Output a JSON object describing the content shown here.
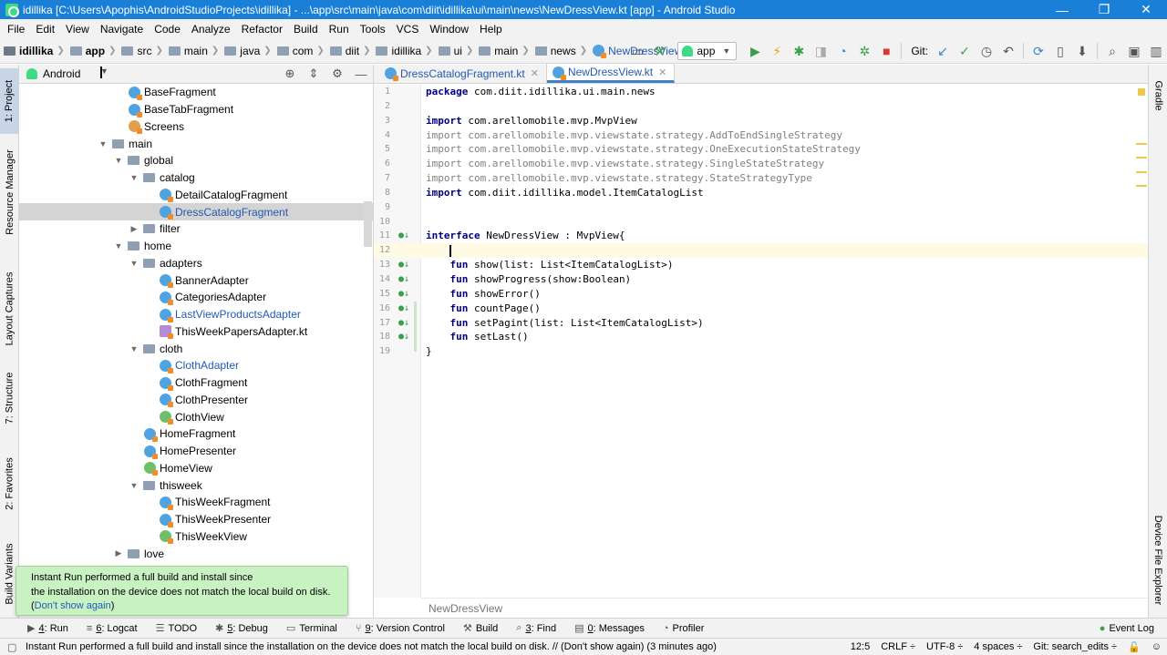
{
  "window": {
    "title": "idillika [C:\\Users\\Apophis\\AndroidStudioProjects\\idillika] - ...\\app\\src\\main\\java\\com\\diit\\idillika\\ui\\main\\news\\NewDressView.kt [app] - Android Studio"
  },
  "menu": [
    "File",
    "Edit",
    "View",
    "Navigate",
    "Code",
    "Analyze",
    "Refactor",
    "Build",
    "Run",
    "Tools",
    "VCS",
    "Window",
    "Help"
  ],
  "breadcrumbs": [
    "idillika",
    "app",
    "src",
    "main",
    "java",
    "com",
    "diit",
    "idillika",
    "ui",
    "main",
    "news",
    "NewDressView.kt"
  ],
  "toolbar": {
    "run_config": "app",
    "git_label": "Git:"
  },
  "left_tabs": [
    "1: Project",
    "Resource Manager",
    "Layout Captures",
    "7: Structure",
    "2: Favorites",
    "Build Variants"
  ],
  "right_tabs": [
    "Gradle",
    "Device File Explorer"
  ],
  "project_panel": {
    "view_mode": "Android"
  },
  "tree": [
    {
      "label": "BaseFragment",
      "indent": 8,
      "kind": "class"
    },
    {
      "label": "BaseTabFragment",
      "indent": 8,
      "kind": "class"
    },
    {
      "label": "Screens",
      "indent": 8,
      "kind": "object"
    },
    {
      "label": "main",
      "indent": 6,
      "kind": "folder",
      "arrow": "open"
    },
    {
      "label": "global",
      "indent": 7,
      "kind": "folder",
      "arrow": "open"
    },
    {
      "label": "catalog",
      "indent": 8,
      "kind": "folder",
      "arrow": "open"
    },
    {
      "label": "DetailCatalogFragment",
      "indent": 10,
      "kind": "class"
    },
    {
      "label": "DressCatalogFragment",
      "indent": 10,
      "kind": "class",
      "selected": true,
      "blue": true
    },
    {
      "label": "filter",
      "indent": 8,
      "kind": "folder",
      "arrow": "closed"
    },
    {
      "label": "home",
      "indent": 7,
      "kind": "folder",
      "arrow": "open"
    },
    {
      "label": "adapters",
      "indent": 8,
      "kind": "folder",
      "arrow": "open"
    },
    {
      "label": "BannerAdapter",
      "indent": 10,
      "kind": "class"
    },
    {
      "label": "CategoriesAdapter",
      "indent": 10,
      "kind": "class"
    },
    {
      "label": "LastViewProductsAdapter",
      "indent": 10,
      "kind": "class",
      "blue": true
    },
    {
      "label": "ThisWeekPapersAdapter.kt",
      "indent": 10,
      "kind": "file"
    },
    {
      "label": "cloth",
      "indent": 8,
      "kind": "folder",
      "arrow": "open"
    },
    {
      "label": "ClothAdapter",
      "indent": 10,
      "kind": "class",
      "blue": true
    },
    {
      "label": "ClothFragment",
      "indent": 10,
      "kind": "class"
    },
    {
      "label": "ClothPresenter",
      "indent": 10,
      "kind": "class"
    },
    {
      "label": "ClothView",
      "indent": 10,
      "kind": "interface"
    },
    {
      "label": "HomeFragment",
      "indent": 9,
      "kind": "class"
    },
    {
      "label": "HomePresenter",
      "indent": 9,
      "kind": "class"
    },
    {
      "label": "HomeView",
      "indent": 9,
      "kind": "interface"
    },
    {
      "label": "thisweek",
      "indent": 8,
      "kind": "folder",
      "arrow": "open"
    },
    {
      "label": "ThisWeekFragment",
      "indent": 10,
      "kind": "class"
    },
    {
      "label": "ThisWeekPresenter",
      "indent": 10,
      "kind": "class"
    },
    {
      "label": "ThisWeekView",
      "indent": 10,
      "kind": "interface"
    },
    {
      "label": "love",
      "indent": 7,
      "kind": "folder",
      "arrow": "closed"
    }
  ],
  "notification": {
    "line1": "Instant Run performed a full build and install since",
    "line2": "the installation on the device does not match the local build on disk.",
    "open_paren": "(",
    "link": "Don't show again",
    "close_paren": ")"
  },
  "editor_tabs": [
    {
      "label": "DressCatalogFragment.kt",
      "active": false
    },
    {
      "label": "NewDressView.kt",
      "active": true
    }
  ],
  "code": [
    {
      "n": "1",
      "parts": [
        [
          "kw",
          "package"
        ],
        [
          "",
          " com.diit.idillika.ui.main.news"
        ]
      ]
    },
    {
      "n": "2",
      "parts": []
    },
    {
      "n": "3",
      "parts": [
        [
          "kw",
          "import"
        ],
        [
          "",
          " com.arellomobile.mvp.MvpView"
        ]
      ]
    },
    {
      "n": "4",
      "parts": [
        [
          "imp",
          "import com.arellomobile.mvp.viewstate.strategy.AddToEndSingleStrategy"
        ]
      ]
    },
    {
      "n": "5",
      "parts": [
        [
          "imp",
          "import com.arellomobile.mvp.viewstate.strategy.OneExecutionStateStrategy"
        ]
      ]
    },
    {
      "n": "6",
      "parts": [
        [
          "imp",
          "import com.arellomobile.mvp.viewstate.strategy.SingleStateStrategy"
        ]
      ]
    },
    {
      "n": "7",
      "parts": [
        [
          "imp",
          "import com.arellomobile.mvp.viewstate.strategy.StateStrategyType"
        ]
      ]
    },
    {
      "n": "8",
      "parts": [
        [
          "kw",
          "import"
        ],
        [
          "",
          " com.diit.idillika.model.ItemCatalogList"
        ]
      ]
    },
    {
      "n": "9",
      "parts": []
    },
    {
      "n": "10",
      "parts": []
    },
    {
      "n": "11",
      "parts": [
        [
          "kw",
          "interface"
        ],
        [
          "",
          " NewDressView : MvpView{"
        ]
      ],
      "mark": true
    },
    {
      "n": "12",
      "parts": [],
      "current": true
    },
    {
      "n": "13",
      "parts": [
        [
          "",
          "    "
        ],
        [
          "kw",
          "fun"
        ],
        [
          "",
          " show(list: List<ItemCatalogList>)"
        ]
      ],
      "mark": true
    },
    {
      "n": "14",
      "parts": [
        [
          "",
          "    "
        ],
        [
          "kw",
          "fun"
        ],
        [
          "",
          " showProgress(show:Boolean)"
        ]
      ],
      "mark": true
    },
    {
      "n": "15",
      "parts": [
        [
          "",
          "    "
        ],
        [
          "kw",
          "fun"
        ],
        [
          "",
          " showError()"
        ]
      ],
      "mark": true
    },
    {
      "n": "16",
      "parts": [
        [
          "",
          "    "
        ],
        [
          "kw",
          "fun"
        ],
        [
          "",
          " countPage()"
        ]
      ],
      "mark": true
    },
    {
      "n": "17",
      "parts": [
        [
          "",
          "    "
        ],
        [
          "kw",
          "fun"
        ],
        [
          "",
          " setPagint(list: List<ItemCatalogList>)"
        ]
      ],
      "mark": true
    },
    {
      "n": "18",
      "parts": [
        [
          "",
          "    "
        ],
        [
          "kw",
          "fun"
        ],
        [
          "",
          " setLast()"
        ]
      ],
      "mark": true
    },
    {
      "n": "19",
      "parts": [
        [
          "",
          "}"
        ]
      ]
    }
  ],
  "editor_breadcrumb": "NewDressView",
  "bottom_tools": [
    {
      "icon": "▶",
      "num": "4",
      "label": ": Run"
    },
    {
      "icon": "≡",
      "num": "6",
      "label": ": Logcat"
    },
    {
      "icon": "☰",
      "num": "",
      "label": "TODO"
    },
    {
      "icon": "✱",
      "num": "5",
      "label": ": Debug"
    },
    {
      "icon": "▭",
      "num": "",
      "label": "Terminal"
    },
    {
      "icon": "⑂",
      "num": "9",
      "label": ": Version Control"
    },
    {
      "icon": "⚒",
      "num": "",
      "label": "Build"
    },
    {
      "icon": "⌕",
      "num": "3",
      "label": ": Find"
    },
    {
      "icon": "▤",
      "num": "0",
      "label": ": Messages"
    },
    {
      "icon": "◔",
      "num": "",
      "label": "Profiler"
    }
  ],
  "event_log": "Event Log",
  "status": {
    "message": "Instant Run performed a full build and install since the installation on the device does not match the local build on disk. // (Don't show again) (3 minutes ago)",
    "position": "12:5",
    "line_sep": "CRLF ÷",
    "encoding": "UTF-8 ÷",
    "indent": "4 spaces ÷",
    "git": "Git: search_edits ÷"
  }
}
